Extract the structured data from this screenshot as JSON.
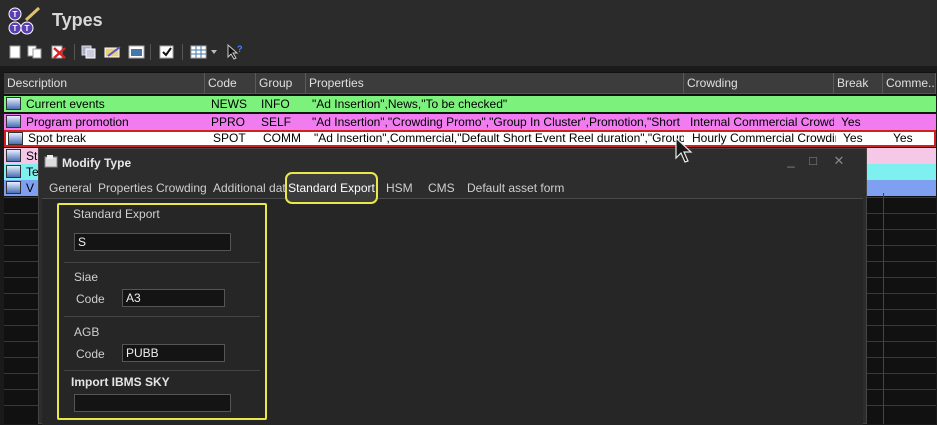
{
  "window": {
    "title": "Types"
  },
  "toolbar": {
    "buttons": [
      {
        "icon": "new-icon"
      },
      {
        "icon": "copy-icon"
      },
      {
        "icon": "delete-icon"
      },
      {
        "icon": "duplicate-icon"
      },
      {
        "icon": "edit-icon"
      },
      {
        "icon": "properties-icon"
      },
      {
        "icon": "checkbox-icon"
      },
      {
        "icon": "grid-view-icon"
      },
      {
        "icon": "dropdown-icon"
      },
      {
        "icon": "pointer-help-icon"
      }
    ]
  },
  "grid": {
    "columns": [
      "Description",
      "Code",
      "Group",
      "Properties",
      "Crowding",
      "Break",
      "Comme..."
    ],
    "rows": [
      {
        "description": "Current events",
        "code": "NEWS",
        "group": "INFO",
        "properties": "\"Ad Insertion\",News,\"To be checked\"",
        "crowding": "",
        "break": "",
        "comment": "",
        "color": "#7cf27c"
      },
      {
        "description": "Program promotion",
        "code": "PPRO",
        "group": "SELF",
        "properties": "\"Ad Insertion\",\"Crowding Promo\",\"Group In Cluster\",Promotion,\"Short Event...",
        "crowding": "Internal Commercial Crowdi...",
        "break": "Yes",
        "comment": "",
        "color": "#f07cf0"
      },
      {
        "description": "Spot break",
        "code": "SPOT",
        "group": "COMM",
        "properties": "\"Ad Insertion\",Commercial,\"Default Short Event Reel duration\",\"Group In Cl...",
        "crowding": "Hourly Commercial Crowding",
        "break": "Yes",
        "comment": "Yes",
        "color": "#ffffff"
      },
      {
        "description": "St",
        "color": "#f5c8e8"
      },
      {
        "description": "Te",
        "color": "#7ef0f0"
      },
      {
        "description": "V",
        "color": "#7fa0f0"
      }
    ]
  },
  "dialog": {
    "title": "Modify Type",
    "controls": {
      "minimize": "_",
      "maximize": "□",
      "close": "✕"
    },
    "tabs": [
      "General",
      "Properties",
      "Crowding",
      "Additional data",
      "Standard Export",
      "HSM",
      "CMS",
      "Default asset form"
    ],
    "active_tab": "Standard Export",
    "standard_export": {
      "group_label": "Standard Export",
      "value": "S"
    },
    "siae": {
      "group_label": "Siae",
      "code_label": "Code",
      "code_value": "A3"
    },
    "agb": {
      "group_label": "AGB",
      "code_label": "Code",
      "code_value": "PUBB"
    },
    "import_ibms": {
      "group_label": "Import IBMS SKY",
      "value": ""
    }
  },
  "colors": {
    "highlight": "#e8e84a",
    "background": "#2b2b2b"
  }
}
